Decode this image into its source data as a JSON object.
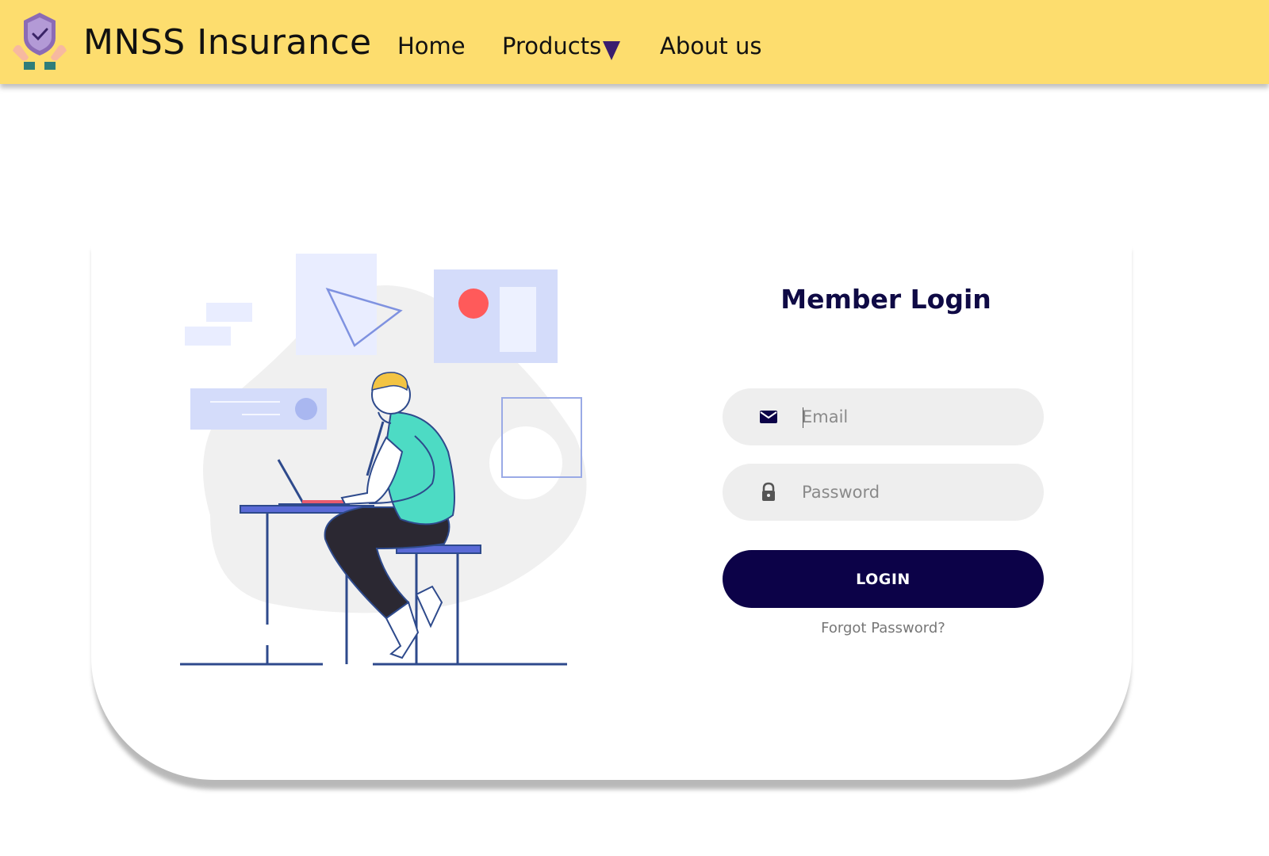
{
  "header": {
    "brand": "MNSS Insurance",
    "logo_icon": "shield-check-hands-icon",
    "nav": {
      "home": "Home",
      "products": "Products",
      "about": "About us"
    },
    "colors": {
      "background": "#fddd6e",
      "caret": "#3a1d6e"
    }
  },
  "login": {
    "title": "Member Login",
    "email": {
      "placeholder": "Email",
      "value": "",
      "icon": "envelope-icon"
    },
    "password": {
      "placeholder": "Password",
      "value": "",
      "icon": "lock-icon"
    },
    "button_label": "LOGIN",
    "forgot_label": "Forgot Password?",
    "colors": {
      "accent": "#0c0248",
      "title": "#0f0a45",
      "field_bg": "#eeeeee"
    }
  },
  "illustration": {
    "subject": "person-working-on-laptop-illustration"
  }
}
